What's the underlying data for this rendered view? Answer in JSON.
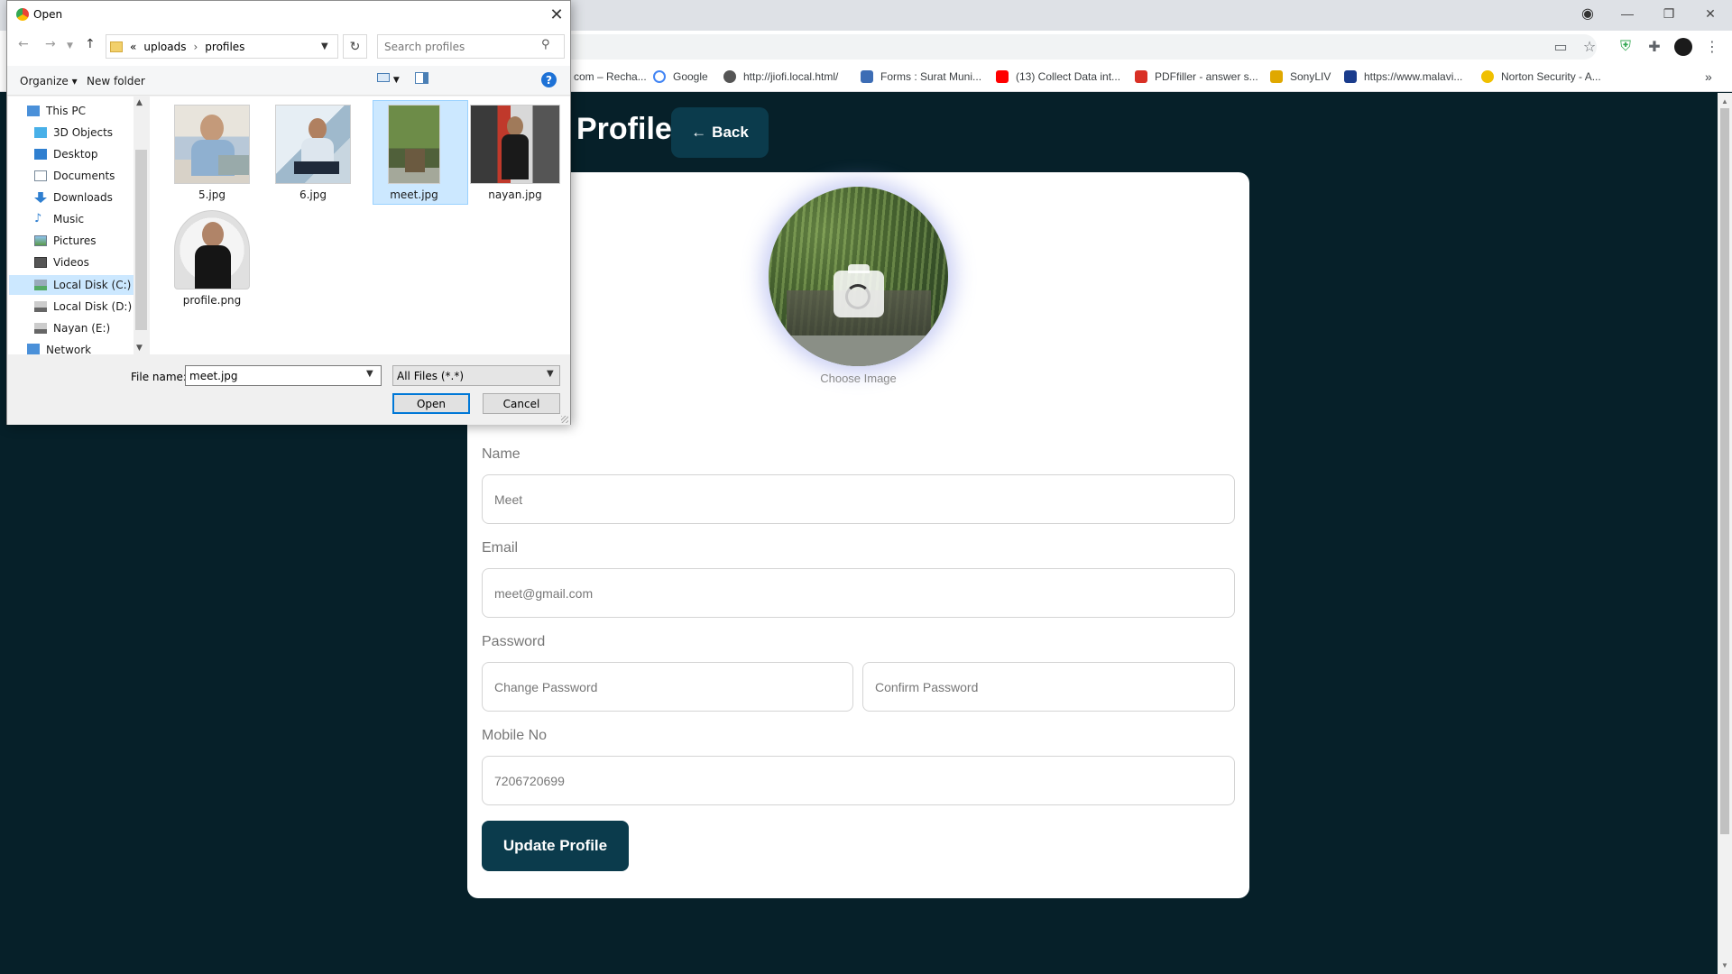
{
  "browser": {
    "window_controls": {
      "minimize": "—",
      "restore": "❐",
      "close": "✕"
    },
    "bookmarks": [
      {
        "label": "com – Recha...",
        "color": "#4a90d9"
      },
      {
        "label": "Google",
        "color": "#4285f4"
      },
      {
        "label": "http://jiofi.local.html/",
        "color": "#555555"
      },
      {
        "label": "Forms : Surat Muni...",
        "color": "#3d6db5"
      },
      {
        "label": "(13) Collect Data int...",
        "color": "#ff0000"
      },
      {
        "label": "PDFfiller - answer s...",
        "color": "#d93025"
      },
      {
        "label": "SonyLIV",
        "color": "#e0a800"
      },
      {
        "label": "https://www.malavi...",
        "color": "#1a3c8c"
      },
      {
        "label": "Norton Security - A...",
        "color": "#f0c000"
      }
    ],
    "bookmarks_more": "»"
  },
  "page": {
    "heading": "Profile",
    "back_button": {
      "icon": "arrow-left-icon",
      "label": "Back"
    },
    "avatar": {
      "caption": "Choose Image",
      "icon": "camera-icon"
    },
    "form": {
      "name": {
        "label": "Name",
        "value": "Meet"
      },
      "email": {
        "label": "Email",
        "value": "meet@gmail.com"
      },
      "password": {
        "label": "Password",
        "change_placeholder": "Change Password",
        "confirm_placeholder": "Confirm Password"
      },
      "mobile": {
        "label": "Mobile No",
        "value": "7206720699"
      }
    },
    "update_button": "Update Profile",
    "colors": {
      "background": "#062029",
      "accent": "#0b3b4c",
      "card": "#ffffff"
    }
  },
  "dialog": {
    "title": "Open",
    "close": "✕",
    "breadcrumb": {
      "prefix": "«",
      "items": [
        "uploads",
        "profiles"
      ],
      "separator": "›"
    },
    "search_placeholder": "Search profiles",
    "commands": {
      "organize": "Organize ▾",
      "new_folder": "New folder"
    },
    "help": "?",
    "nav_items": [
      {
        "label": "This PC",
        "icon": "pc-icon"
      },
      {
        "label": "3D Objects",
        "icon": "3d-objects-icon"
      },
      {
        "label": "Desktop",
        "icon": "desktop-icon"
      },
      {
        "label": "Documents",
        "icon": "documents-icon"
      },
      {
        "label": "Downloads",
        "icon": "downloads-icon"
      },
      {
        "label": "Music",
        "icon": "music-icon"
      },
      {
        "label": "Pictures",
        "icon": "pictures-icon"
      },
      {
        "label": "Videos",
        "icon": "videos-icon"
      },
      {
        "label": "Local Disk (C:)",
        "icon": "drive-icon"
      },
      {
        "label": "Local Disk (D:)",
        "icon": "drive-icon"
      },
      {
        "label": "Nayan (E:)",
        "icon": "drive-icon"
      },
      {
        "label": "Network",
        "icon": "network-icon"
      }
    ],
    "selected_nav": "Local Disk (C:)",
    "files": [
      {
        "name": "5.jpg"
      },
      {
        "name": "6.jpg"
      },
      {
        "name": "meet.jpg"
      },
      {
        "name": "nayan.jpg"
      },
      {
        "name": "profile.png"
      }
    ],
    "selected_file": "meet.jpg",
    "file_name_label": "File name:",
    "file_name_value": "meet.jpg",
    "file_type": "All Files (*.*)",
    "open_button": "Open",
    "cancel_button": "Cancel"
  }
}
